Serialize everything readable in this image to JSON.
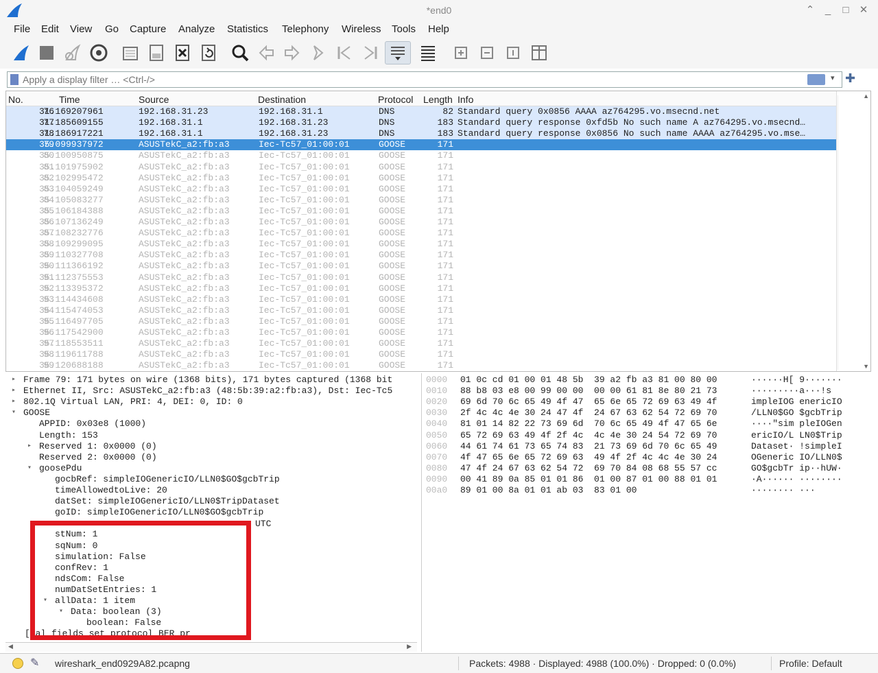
{
  "window": {
    "title": "*end0"
  },
  "menu": [
    "File",
    "Edit",
    "View",
    "Go",
    "Capture",
    "Analyze",
    "Statistics",
    "Telephony",
    "Wireless",
    "Tools",
    "Help"
  ],
  "filter": {
    "placeholder": "Apply a display filter … <Ctrl-/>"
  },
  "columns": [
    "No.",
    "Time",
    "Source",
    "Destination",
    "Protocol",
    "Length",
    "Info"
  ],
  "packets": [
    {
      "no": "76",
      "time": "31.169207961",
      "src": "192.168.31.23",
      "dst": "192.168.31.1",
      "proto": "DNS",
      "len": "82",
      "info": "Standard query 0x0856 AAAA az764295.vo.msecnd.net",
      "kind": "dns"
    },
    {
      "no": "77",
      "time": "31.185609155",
      "src": "192.168.31.1",
      "dst": "192.168.31.23",
      "proto": "DNS",
      "len": "183",
      "info": "Standard query response 0xfd5b No such name A az764295.vo.msecnd…",
      "kind": "dns"
    },
    {
      "no": "78",
      "time": "31.186917221",
      "src": "192.168.31.1",
      "dst": "192.168.31.23",
      "proto": "DNS",
      "len": "183",
      "info": "Standard query response 0x0856 No such name AAAA az764295.vo.mse…",
      "kind": "dns"
    },
    {
      "no": "79",
      "time": "35.099937972",
      "src": "ASUSTekC_a2:fb:a3",
      "dst": "Iec-Tc57_01:00:01",
      "proto": "GOOSE",
      "len": "171",
      "info": "",
      "kind": "selected"
    },
    {
      "no": "80",
      "time": "35.100950875",
      "src": "ASUSTekC_a2:fb:a3",
      "dst": "Iec-Tc57_01:00:01",
      "proto": "GOOSE",
      "len": "171",
      "info": "",
      "kind": "goose"
    },
    {
      "no": "81",
      "time": "35.101975902",
      "src": "ASUSTekC_a2:fb:a3",
      "dst": "Iec-Tc57_01:00:01",
      "proto": "GOOSE",
      "len": "171",
      "info": "",
      "kind": "goose"
    },
    {
      "no": "82",
      "time": "35.102995472",
      "src": "ASUSTekC_a2:fb:a3",
      "dst": "Iec-Tc57_01:00:01",
      "proto": "GOOSE",
      "len": "171",
      "info": "",
      "kind": "goose"
    },
    {
      "no": "83",
      "time": "35.104059249",
      "src": "ASUSTekC_a2:fb:a3",
      "dst": "Iec-Tc57_01:00:01",
      "proto": "GOOSE",
      "len": "171",
      "info": "",
      "kind": "goose"
    },
    {
      "no": "84",
      "time": "35.105083277",
      "src": "ASUSTekC_a2:fb:a3",
      "dst": "Iec-Tc57_01:00:01",
      "proto": "GOOSE",
      "len": "171",
      "info": "",
      "kind": "goose"
    },
    {
      "no": "85",
      "time": "35.106184388",
      "src": "ASUSTekC_a2:fb:a3",
      "dst": "Iec-Tc57_01:00:01",
      "proto": "GOOSE",
      "len": "171",
      "info": "",
      "kind": "goose"
    },
    {
      "no": "86",
      "time": "35.107136249",
      "src": "ASUSTekC_a2:fb:a3",
      "dst": "Iec-Tc57_01:00:01",
      "proto": "GOOSE",
      "len": "171",
      "info": "",
      "kind": "goose"
    },
    {
      "no": "87",
      "time": "35.108232776",
      "src": "ASUSTekC_a2:fb:a3",
      "dst": "Iec-Tc57_01:00:01",
      "proto": "GOOSE",
      "len": "171",
      "info": "",
      "kind": "goose"
    },
    {
      "no": "88",
      "time": "35.109299095",
      "src": "ASUSTekC_a2:fb:a3",
      "dst": "Iec-Tc57_01:00:01",
      "proto": "GOOSE",
      "len": "171",
      "info": "",
      "kind": "goose"
    },
    {
      "no": "89",
      "time": "35.110327708",
      "src": "ASUSTekC_a2:fb:a3",
      "dst": "Iec-Tc57_01:00:01",
      "proto": "GOOSE",
      "len": "171",
      "info": "",
      "kind": "goose"
    },
    {
      "no": "90",
      "time": "35.111366192",
      "src": "ASUSTekC_a2:fb:a3",
      "dst": "Iec-Tc57_01:00:01",
      "proto": "GOOSE",
      "len": "171",
      "info": "",
      "kind": "goose"
    },
    {
      "no": "91",
      "time": "35.112375553",
      "src": "ASUSTekC_a2:fb:a3",
      "dst": "Iec-Tc57_01:00:01",
      "proto": "GOOSE",
      "len": "171",
      "info": "",
      "kind": "goose"
    },
    {
      "no": "92",
      "time": "35.113395372",
      "src": "ASUSTekC_a2:fb:a3",
      "dst": "Iec-Tc57_01:00:01",
      "proto": "GOOSE",
      "len": "171",
      "info": "",
      "kind": "goose"
    },
    {
      "no": "93",
      "time": "35.114434608",
      "src": "ASUSTekC_a2:fb:a3",
      "dst": "Iec-Tc57_01:00:01",
      "proto": "GOOSE",
      "len": "171",
      "info": "",
      "kind": "goose"
    },
    {
      "no": "94",
      "time": "35.115474053",
      "src": "ASUSTekC_a2:fb:a3",
      "dst": "Iec-Tc57_01:00:01",
      "proto": "GOOSE",
      "len": "171",
      "info": "",
      "kind": "goose"
    },
    {
      "no": "95",
      "time": "35.116497705",
      "src": "ASUSTekC_a2:fb:a3",
      "dst": "Iec-Tc57_01:00:01",
      "proto": "GOOSE",
      "len": "171",
      "info": "",
      "kind": "goose"
    },
    {
      "no": "96",
      "time": "35.117542900",
      "src": "ASUSTekC_a2:fb:a3",
      "dst": "Iec-Tc57_01:00:01",
      "proto": "GOOSE",
      "len": "171",
      "info": "",
      "kind": "goose"
    },
    {
      "no": "97",
      "time": "35.118553511",
      "src": "ASUSTekC_a2:fb:a3",
      "dst": "Iec-Tc57_01:00:01",
      "proto": "GOOSE",
      "len": "171",
      "info": "",
      "kind": "goose"
    },
    {
      "no": "98",
      "time": "35.119611788",
      "src": "ASUSTekC_a2:fb:a3",
      "dst": "Iec-Tc57_01:00:01",
      "proto": "GOOSE",
      "len": "171",
      "info": "",
      "kind": "goose"
    },
    {
      "no": "99",
      "time": "35.120688188",
      "src": "ASUSTekC_a2:fb:a3",
      "dst": "Iec-Tc57_01:00:01",
      "proto": "GOOSE",
      "len": "171",
      "info": "",
      "kind": "goose"
    }
  ],
  "details": [
    {
      "indent": 0,
      "tw": "right",
      "text": "Frame 79: 171 bytes on wire (1368 bits), 171 bytes captured (1368 bit"
    },
    {
      "indent": 0,
      "tw": "right",
      "text": "Ethernet II, Src: ASUSTekC_a2:fb:a3 (48:5b:39:a2:fb:a3), Dst: Iec-Tc5"
    },
    {
      "indent": 0,
      "tw": "right",
      "text": "802.1Q Virtual LAN, PRI: 4, DEI: 0, ID: 0"
    },
    {
      "indent": 0,
      "tw": "down",
      "text": "GOOSE"
    },
    {
      "indent": 1,
      "tw": "",
      "text": "APPID: 0x03e8 (1000)"
    },
    {
      "indent": 1,
      "tw": "",
      "text": "Length: 153"
    },
    {
      "indent": 1,
      "tw": "right",
      "text": "Reserved 1: 0x0000 (0)"
    },
    {
      "indent": 1,
      "tw": "",
      "text": "Reserved 2: 0x0000 (0)"
    },
    {
      "indent": 1,
      "tw": "down",
      "text": "goosePdu"
    },
    {
      "indent": 2,
      "tw": "",
      "text": "gocbRef: simpleIOGenericIO/LLN0$GO$gcbTrip"
    },
    {
      "indent": 2,
      "tw": "",
      "text": "timeAllowedtoLive: 20"
    },
    {
      "indent": 2,
      "tw": "",
      "text": "datSet: simpleIOGenericIO/LLN0$TripDataset"
    },
    {
      "indent": 2,
      "tw": "",
      "text": "goID: simpleIOGenericIO/LLN0$GO$gcbTrip"
    },
    {
      "indent": 2,
      "tw": "",
      "text": ""
    },
    {
      "indent": 2,
      "tw": "",
      "text": "stNum: 1"
    },
    {
      "indent": 2,
      "tw": "",
      "text": "sqNum: 0"
    },
    {
      "indent": 2,
      "tw": "",
      "text": "simulation: False"
    },
    {
      "indent": 2,
      "tw": "",
      "text": "confRev: 1"
    },
    {
      "indent": 2,
      "tw": "",
      "text": "ndsCom: False"
    },
    {
      "indent": 2,
      "tw": "",
      "text": "numDatSetEntries: 1"
    },
    {
      "indent": 2,
      "tw": "down",
      "text": "allData: 1 item"
    },
    {
      "indent": 3,
      "tw": "down",
      "text": "Data: boolean (3)"
    },
    {
      "indent": 4,
      "tw": "",
      "text": "boolean: False"
    },
    {
      "indent": 0,
      "tw": "",
      "text": "[                    al fields set protocol BER pr"
    }
  ],
  "utc_text": "UTC",
  "bytes": [
    {
      "off": "0000",
      "hex": "01 0c cd 01 00 01 48 5b  39 a2 fb a3 81 00 80 00",
      "asc": "······H[ 9·······"
    },
    {
      "off": "0010",
      "hex": "88 b8 03 e8 00 99 00 00  00 00 61 81 8e 80 21 73",
      "asc": "·········a···!s"
    },
    {
      "off": "0020",
      "hex": "69 6d 70 6c 65 49 4f 47  65 6e 65 72 69 63 49 4f",
      "asc": "impleIOG enericIO"
    },
    {
      "off": "0030",
      "hex": "2f 4c 4c 4e 30 24 47 4f  24 67 63 62 54 72 69 70",
      "asc": "/LLN0$GO $gcbTrip"
    },
    {
      "off": "0040",
      "hex": "81 01 14 82 22 73 69 6d  70 6c 65 49 4f 47 65 6e",
      "asc": "····\"sim pleIOGen"
    },
    {
      "off": "0050",
      "hex": "65 72 69 63 49 4f 2f 4c  4c 4e 30 24 54 72 69 70",
      "asc": "ericIO/L LN0$Trip"
    },
    {
      "off": "0060",
      "hex": "44 61 74 61 73 65 74 83  21 73 69 6d 70 6c 65 49",
      "asc": "Dataset· !simpleI"
    },
    {
      "off": "0070",
      "hex": "4f 47 65 6e 65 72 69 63  49 4f 2f 4c 4c 4e 30 24",
      "asc": "OGeneric IO/LLN0$"
    },
    {
      "off": "0080",
      "hex": "47 4f 24 67 63 62 54 72  69 70 84 08 68 55 57 cc",
      "asc": "GO$gcbTr ip··hUW·"
    },
    {
      "off": "0090",
      "hex": "00 41 89 0a 85 01 01 86  01 00 87 01 00 88 01 01",
      "asc": "·A······ ········"
    },
    {
      "off": "00a0",
      "hex": "89 01 00 8a 01 01 ab 03  83 01 00",
      "asc": "········ ···"
    }
  ],
  "status": {
    "file": "wireshark_end0929A82.pcapng",
    "stats": "Packets: 4988 · Displayed: 4988 (100.0%) · Dropped: 0 (0.0%)",
    "profile": "Profile: Default"
  },
  "colors": {
    "selected": "#3d8fd8",
    "dns_row": "#dae8fc",
    "highlight_box": "#e0181f"
  },
  "toolbar_icons": [
    "start-capture-icon",
    "stop-capture-icon",
    "restart-capture-icon",
    "capture-options-icon",
    "open-file-icon",
    "save-file-icon",
    "close-file-icon",
    "reload-file-icon",
    "find-packet-icon",
    "go-back-icon",
    "go-forward-icon",
    "go-to-packet-icon",
    "first-packet-icon",
    "last-packet-icon",
    "autoscroll-icon",
    "colorize-icon",
    "zoom-in-icon",
    "zoom-out-icon",
    "normal-size-icon",
    "resize-columns-icon"
  ]
}
